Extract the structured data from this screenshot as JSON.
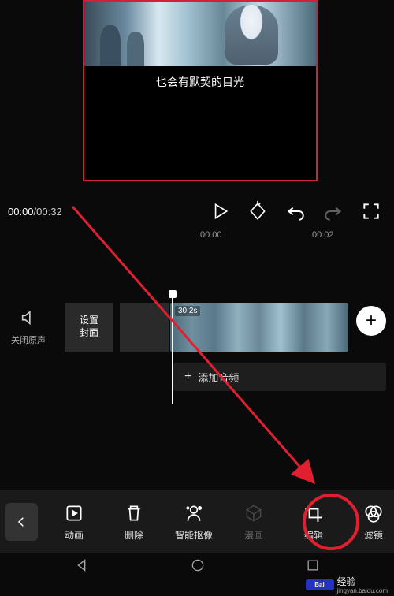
{
  "preview": {
    "subtitle": "也会有默契的目光"
  },
  "playback": {
    "current": "00:00",
    "total": "00:32"
  },
  "ruler": {
    "marks": [
      "00:00",
      "00:02"
    ]
  },
  "timeline": {
    "mute_label": "关闭原声",
    "cover_line1": "设置",
    "cover_line2": "封面",
    "clip_duration": "30.2s",
    "add_audio": "添加音频"
  },
  "toolbar": {
    "items": [
      {
        "key": "animation",
        "label": "动画"
      },
      {
        "key": "delete",
        "label": "删除"
      },
      {
        "key": "cutout",
        "label": "智能抠像"
      },
      {
        "key": "comic",
        "label": "漫画"
      },
      {
        "key": "edit",
        "label": "编辑"
      },
      {
        "key": "filter",
        "label": "滤镜"
      }
    ]
  },
  "watermark": {
    "brand": "Bai",
    "label": "经验",
    "url": "jingyan.baidu.com"
  }
}
